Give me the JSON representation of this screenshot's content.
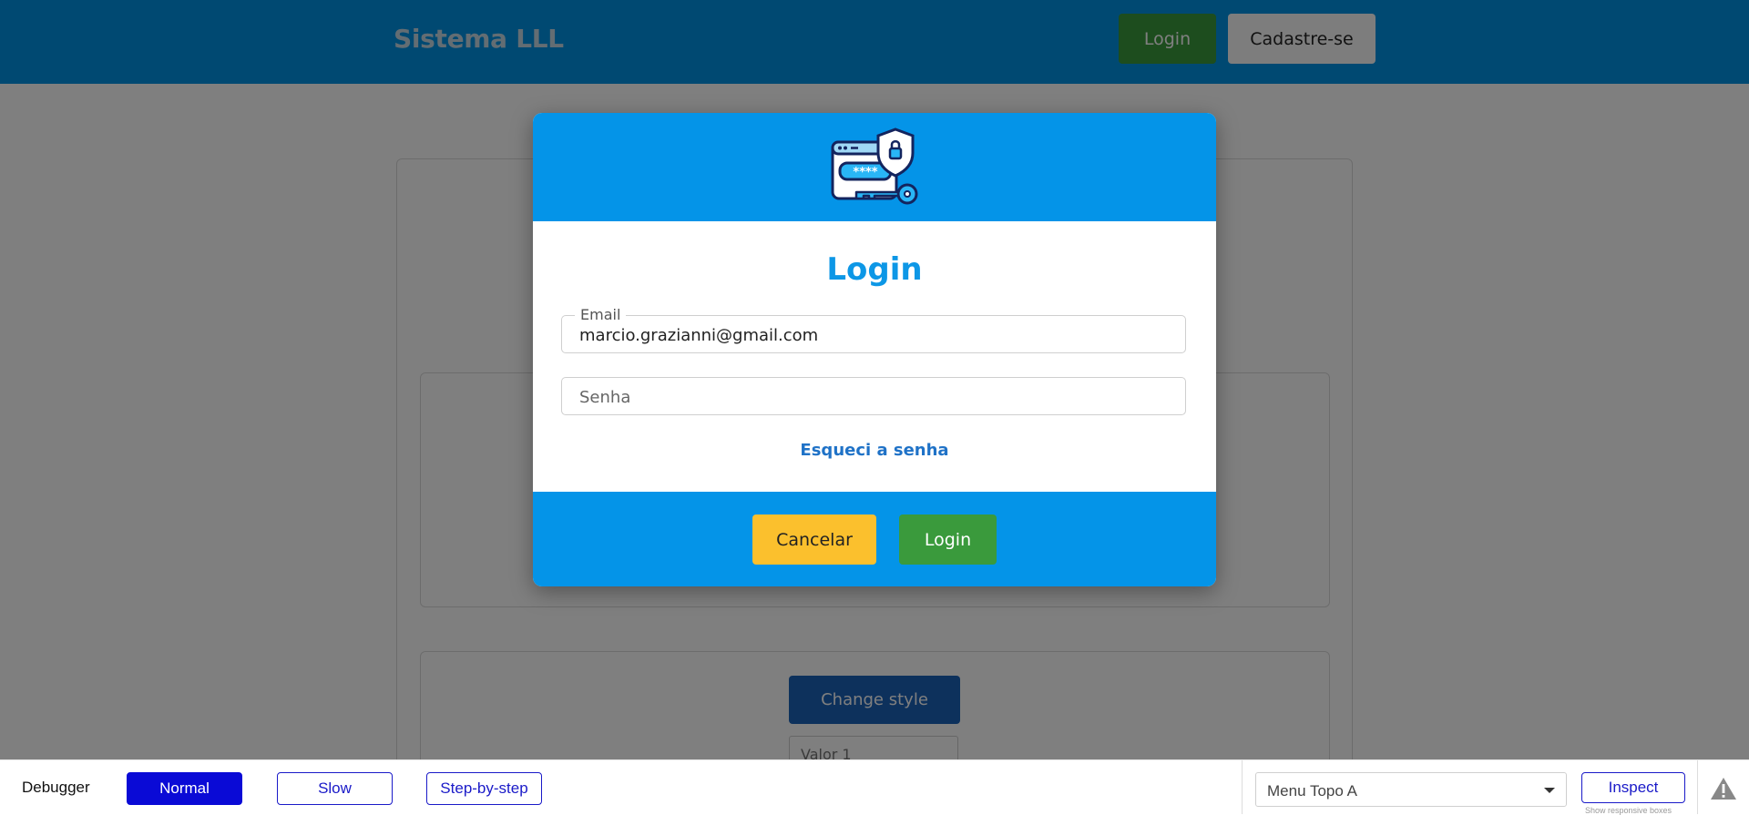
{
  "app": {
    "brand": "Sistema LLL",
    "nav": {
      "login_label": "Login",
      "signup_label": "Cadastre-se"
    },
    "background": {
      "change_style_label": "Change style",
      "valor_placeholder": "Valor 1"
    }
  },
  "modal": {
    "icon": "password-security-icon",
    "title": "Login",
    "email": {
      "legend": "Email",
      "value": "marcio.grazianni@gmail.com"
    },
    "senha": {
      "placeholder": "Senha"
    },
    "forgot_label": "Esqueci a senha",
    "cancel_label": "Cancelar",
    "login_label": "Login",
    "colors": {
      "header": "#0494e8",
      "title": "#0d97e6",
      "cancel": "#fbc02d",
      "login": "#3a9a3c"
    }
  },
  "debugger": {
    "label": "Debugger",
    "modes": [
      "Normal",
      "Slow",
      "Step-by-step"
    ],
    "active_mode": "Normal",
    "menu_select": "Menu Topo A",
    "inspect_label": "Inspect",
    "inspect_hint": "Show responsive boxes",
    "warning_icon": "warning-icon"
  }
}
